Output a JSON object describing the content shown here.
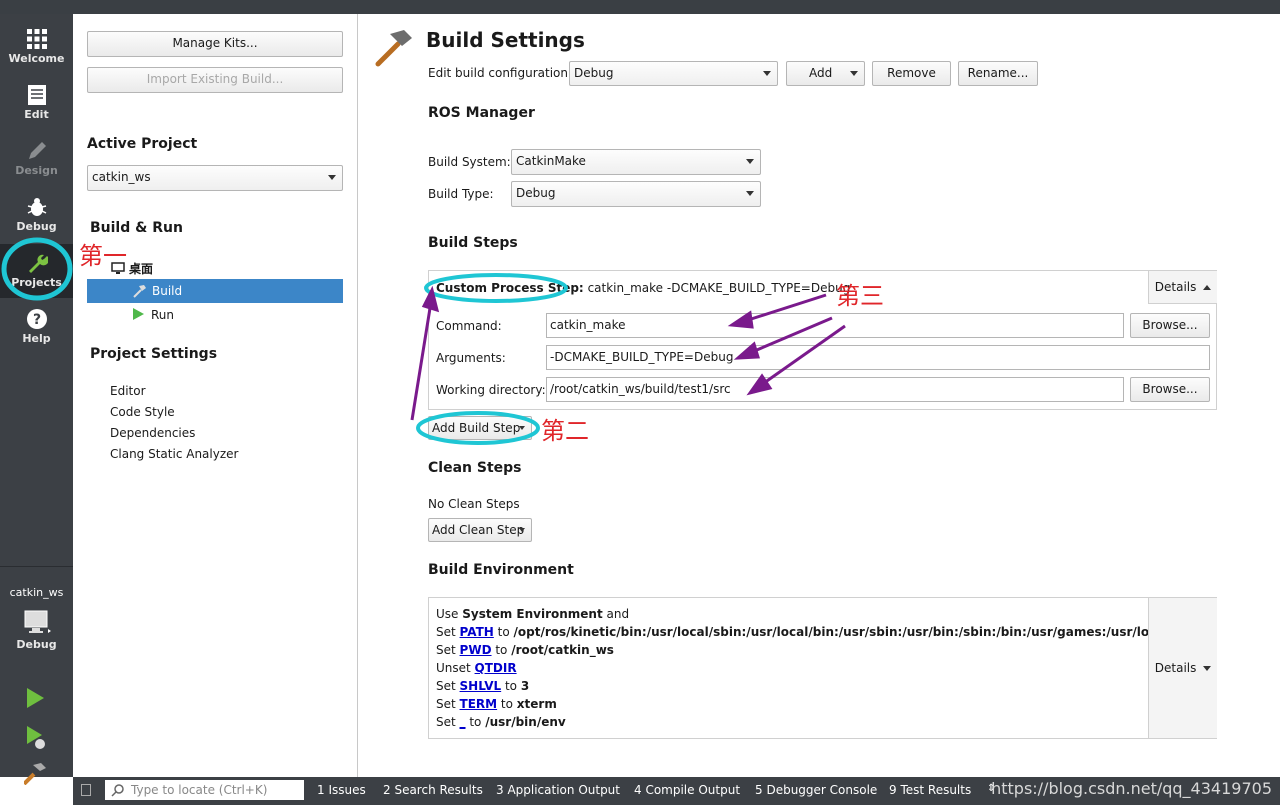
{
  "modes": {
    "welcome": "Welcome",
    "edit": "Edit",
    "design": "Design",
    "debug": "Debug",
    "projects": "Projects",
    "help": "Help"
  },
  "kit": {
    "project_name": "catkin_ws",
    "build_mode": "Debug"
  },
  "project_panel": {
    "manage_kits": "Manage Kits...",
    "import_build": "Import Existing Build...",
    "active_project_heading": "Active Project",
    "active_project_value": "catkin_ws",
    "build_run_heading": "Build & Run",
    "kit_name": "桌面",
    "build_item": "Build",
    "run_item": "Run",
    "project_settings_heading": "Project Settings",
    "settings_items": [
      "Editor",
      "Code Style",
      "Dependencies",
      "Clang Static Analyzer"
    ]
  },
  "build_settings": {
    "title": "Build Settings",
    "edit_config_label": "Edit build configuration:",
    "edit_config_value": "Debug",
    "add_button": "Add",
    "remove_button": "Remove",
    "rename_button": "Rename...",
    "ros_manager_heading": "ROS Manager",
    "build_system_label": "Build System:",
    "build_system_value": "CatkinMake",
    "build_type_label": "Build Type:",
    "build_type_value": "Debug",
    "build_steps_heading": "Build Steps",
    "custom_step_title": "Custom Process Step:",
    "custom_step_summary": "catkin_make -DCMAKE_BUILD_TYPE=Debug",
    "details_label": "Details",
    "command_label": "Command:",
    "command_value": "catkin_make",
    "arguments_label": "Arguments:",
    "arguments_value": "-DCMAKE_BUILD_TYPE=Debug",
    "workdir_label": "Working directory:",
    "workdir_value": "/root/catkin_ws/build/test1/src",
    "browse_label": "Browse...",
    "add_build_step": "Add Build Step",
    "clean_steps_heading": "Clean Steps",
    "no_clean_steps": "No Clean Steps",
    "add_clean_step": "Add Clean Step",
    "build_env_heading": "Build Environment",
    "env": {
      "l1_a": "Use ",
      "l1_b": "System Environment",
      "l1_c": " and",
      "l2_a": "Set ",
      "l2_var": "PATH",
      "l2_to": " to ",
      "l2_val": "/opt/ros/kinetic/bin:/usr/local/sbin:/usr/local/bin:/usr/sbin:/usr/bin:/sbin:/bin:/usr/games:/usr/local/games:/",
      "l3_a": "Set ",
      "l3_var": "PWD",
      "l3_to": " to ",
      "l3_val": "/root/catkin_ws",
      "l4_a": "Unset ",
      "l4_var": "QTDIR",
      "l5_a": "Set ",
      "l5_var": "SHLVL",
      "l5_to": " to ",
      "l5_val": "3",
      "l6_a": "Set ",
      "l6_var": "TERM",
      "l6_to": " to ",
      "l6_val": "xterm",
      "l7_a": "Set ",
      "l7_var": "_",
      "l7_to": " to ",
      "l7_val": "/usr/bin/env"
    }
  },
  "status_bar": {
    "locate_placeholder": "Type to locate (Ctrl+K)",
    "items": [
      "1  Issues",
      "2  Search Results",
      "3  Application Output",
      "4  Compile Output",
      "5  Debugger Console",
      "9  Test Results"
    ],
    "watermark": "https://blog.csdn.net/qq_43419705"
  },
  "annotations": {
    "first": "第一",
    "second": "第二",
    "third": "第三"
  },
  "colors": {
    "sidebar": "#3c4045",
    "selection": "#3c86c8",
    "highlight_ring": "#1fc6d4",
    "annotation_text": "#e0262a",
    "arrow": "#7a1a8c"
  }
}
